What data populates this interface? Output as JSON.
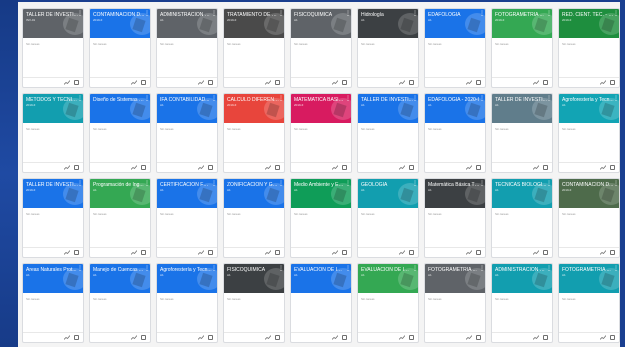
{
  "classroom": {
    "cards": [
      {
        "title": "TALLER DE INVESTI...",
        "subtitle": "INV-01",
        "meta": "Sin tareas",
        "color": "#5f6368"
      },
      {
        "title": "CONTAMINACION D...",
        "subtitle": "2019-II",
        "meta": "Sin tareas",
        "color": "#1a73e8"
      },
      {
        "title": "ADMINISTRACIÓN D...",
        "subtitle": "A1",
        "meta": "Sin tareas",
        "color": "#5f6368"
      },
      {
        "title": "TRATAMIENTO DE R...",
        "subtitle": "2019-II",
        "meta": "Sin tareas",
        "color": "#4a4a4a"
      },
      {
        "title": "FISICOQUÍMICA",
        "subtitle": "A1",
        "meta": "Sin tareas",
        "color": "#5f6368"
      },
      {
        "title": "Hidrología",
        "subtitle": "A1",
        "meta": "Sin tareas",
        "color": "#3c4043"
      },
      {
        "title": "EDAFOLOGÍA",
        "subtitle": "A1",
        "meta": "Sin tareas",
        "color": "#1a73e8"
      },
      {
        "title": "FOTOGRAMETRIA ...",
        "subtitle": "2019-II",
        "meta": "Sin tareas",
        "color": "#34a853"
      },
      {
        "title": "RED. CIENT. TEC. - Ril...",
        "subtitle": "2019-II",
        "meta": "Sin tareas",
        "color": "#1e8e3e"
      },
      {
        "title": "METODOS Y TECNIC...",
        "subtitle": "2019-II",
        "meta": "Sin tareas",
        "color": "#129eaf"
      },
      {
        "title": "Diseño de Sistemas Ep...",
        "subtitle": "",
        "meta": "Sin tareas",
        "color": "#1a73e8"
      },
      {
        "title": "IFA CONTABILIDAD...",
        "subtitle": "A1",
        "meta": "Sin tareas",
        "color": "#1a73e8"
      },
      {
        "title": "CALCULO DIFERENC...",
        "subtitle": "2019-II",
        "meta": "Sin tareas",
        "color": "#e8453c"
      },
      {
        "title": "MATEMATICA BASIC...",
        "subtitle": "2019-II",
        "meta": "Sin tareas",
        "color": "#d81b60"
      },
      {
        "title": "TALLER DE INVESTI...",
        "subtitle": "A1",
        "meta": "Sin tareas",
        "color": "#1a73e8"
      },
      {
        "title": "EDAFOLOGÍA - 2020-I",
        "subtitle": "A1",
        "meta": "Sin tareas",
        "color": "#1a73e8"
      },
      {
        "title": "TALLER DE INVESTI...",
        "subtitle": "A1",
        "meta": "Sin tareas",
        "color": "#607d8b"
      },
      {
        "title": "Agroforestería y Tecn...",
        "subtitle": "A1",
        "meta": "Sin tareas",
        "color": "#12a4b4"
      },
      {
        "title": "TALLER DE INVESTI...",
        "subtitle": "2019-II",
        "meta": "Sin tareas",
        "color": "#1a73e8"
      },
      {
        "title": "Programación de Ing...",
        "subtitle": "A1",
        "meta": "Sin tareas",
        "color": "#34a853"
      },
      {
        "title": "CERTIFICACION FOR...",
        "subtitle": "A1",
        "meta": "Sin tareas",
        "color": "#1a73e8"
      },
      {
        "title": "ZONIFICACIÓN Y GE...",
        "subtitle": "A1",
        "meta": "Sin tareas",
        "color": "#1a73e8"
      },
      {
        "title": "Medio Ambiente y Em...",
        "subtitle": "A1",
        "meta": "Sin tareas",
        "color": "#0f9d58"
      },
      {
        "title": "GEOLOGÍA",
        "subtitle": "A1",
        "meta": "Sin tareas",
        "color": "#129eaf"
      },
      {
        "title": "Matemática Básica TM...",
        "subtitle": "A1",
        "meta": "Sin tareas",
        "color": "#3c4043"
      },
      {
        "title": "TÉCNICAS BIOLÓGI...",
        "subtitle": "A1",
        "meta": "Sin tareas",
        "color": "#129eaf"
      },
      {
        "title": "CONTAMINACIÓN D...",
        "subtitle": "2019-II",
        "meta": "Sin tareas",
        "color": "#4e6b4b"
      },
      {
        "title": "Áreas Naturales Prot...",
        "subtitle": "A1",
        "meta": "Sin tareas",
        "color": "#1a73e8"
      },
      {
        "title": "Manejo de Cuencas ...",
        "subtitle": "A1",
        "meta": "Sin tareas",
        "color": "#1a73e8"
      },
      {
        "title": "Agroforestería y Tecn...",
        "subtitle": "A1",
        "meta": "Sin tareas",
        "color": "#1a73e8"
      },
      {
        "title": "FISICOQUÍMICA",
        "subtitle": "A1",
        "meta": "Sin tareas",
        "color": "#3c4043"
      },
      {
        "title": "EVALUACIÓN DE IMP...",
        "subtitle": "A1",
        "meta": "",
        "color": "#1a73e8"
      },
      {
        "title": "EVALUACIÓN DE IMP...",
        "subtitle": "A1",
        "meta": "Sin tareas",
        "color": "#34a853"
      },
      {
        "title": "FOTOGRAMETRIA ...",
        "subtitle": "A1",
        "meta": "Sin tareas",
        "color": "#5f6368"
      },
      {
        "title": "ADMINISTRACIÓN D...",
        "subtitle": "A1",
        "meta": "Sin tareas",
        "color": "#129eaf"
      },
      {
        "title": "FOTOGRAMETRIA ...",
        "subtitle": "A1",
        "meta": "Sin tareas",
        "color": "#129eaf"
      }
    ],
    "card_menu_icon": "more-vert-icon",
    "footer_icons": [
      "trending-up-icon",
      "folder-icon"
    ]
  }
}
